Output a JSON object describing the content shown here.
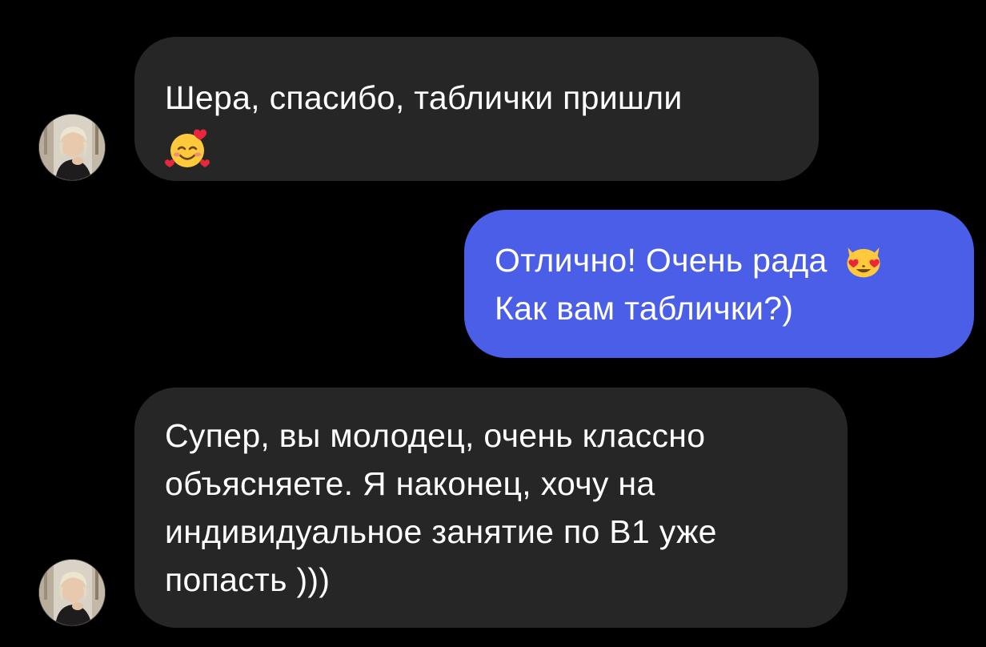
{
  "conversation": {
    "messages": [
      {
        "direction": "incoming",
        "lines": [
          "Шера, спасибо, таблички пришли"
        ],
        "emoji": "smiling-face-with-hearts"
      },
      {
        "direction": "outgoing",
        "lines": [
          "Отлично! Очень рада",
          "Как вам таблички?)"
        ],
        "emoji": "heart-eyes-cat"
      },
      {
        "direction": "incoming",
        "lines": [
          "Супер, вы молодец, очень классно",
          "объясняете. Я наконец, хочу на",
          "индивидуальное занятие по В1 уже",
          "попасть )))"
        ]
      }
    ]
  },
  "colors": {
    "background": "#000000",
    "incoming_bubble": "#262626",
    "outgoing_bubble": "#4b5ee8",
    "text": "#ffffff"
  }
}
